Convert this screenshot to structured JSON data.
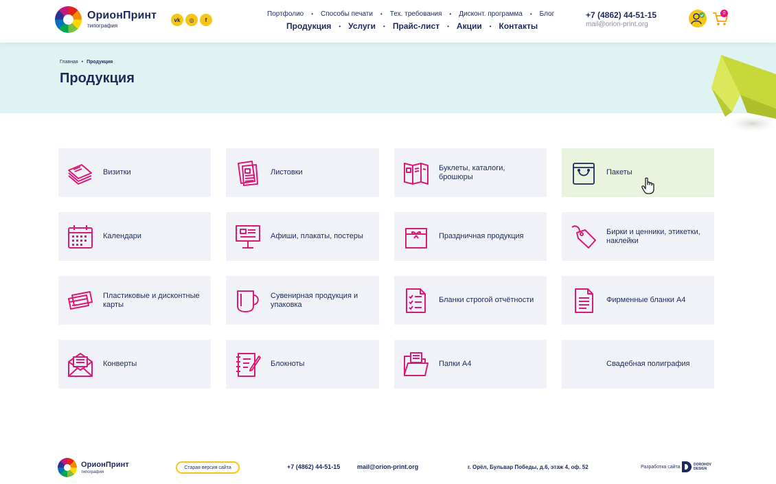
{
  "brand": {
    "name": "ОрионПринт",
    "tagline": "типография"
  },
  "socials": [
    {
      "label": "vk",
      "icon": "vk-icon"
    },
    {
      "label": "◎",
      "icon": "instagram-icon"
    },
    {
      "label": "f",
      "icon": "facebook-icon"
    }
  ],
  "nav": {
    "top": [
      "Портфолио",
      "Способы печати",
      "Тех. требования",
      "Дисконт. программа",
      "Блог"
    ],
    "main": [
      "Продукция",
      "Услуги",
      "Прайс-лист",
      "Акции",
      "Контакты"
    ]
  },
  "contacts": {
    "phone": "+7 (4862) 44-51-15",
    "email": "mail@orion-print.org"
  },
  "cart": {
    "count": "0"
  },
  "breadcrumb": {
    "home": "Главная",
    "current": "Продукция"
  },
  "page_title": "Продукция",
  "products": [
    {
      "label": "Визитки",
      "icon": "business-cards-icon"
    },
    {
      "label": "Листовки",
      "icon": "leaflets-icon"
    },
    {
      "label": "Буклеты, каталоги, брошюры",
      "icon": "booklet-icon"
    },
    {
      "label": "Пакеты",
      "icon": "bag-icon",
      "active": true
    },
    {
      "label": "Календари",
      "icon": "calendar-icon"
    },
    {
      "label": "Афиши, плакаты, постеры",
      "icon": "poster-icon"
    },
    {
      "label": "Праздничная продукция",
      "icon": "gift-box-icon"
    },
    {
      "label": "Бирки и ценники, этикетки, наклейки",
      "icon": "tag-icon"
    },
    {
      "label": "Пластиковые и дисконтные карты",
      "icon": "plastic-cards-icon"
    },
    {
      "label": "Сувенирная продукция и упаковка",
      "icon": "mug-icon"
    },
    {
      "label": "Бланки строгой отчётности",
      "icon": "checklist-form-icon"
    },
    {
      "label": "Фирменные бланки А4",
      "icon": "letterhead-icon"
    },
    {
      "label": "Конверты",
      "icon": "envelope-icon"
    },
    {
      "label": "Блокноты",
      "icon": "notepad-icon"
    },
    {
      "label": "Папки А4",
      "icon": "folder-icon"
    },
    {
      "label": "Свадебная полиграфия",
      "icon": ""
    }
  ],
  "footer": {
    "old_site": "Старая версия сайта",
    "phone": "+7 (4862) 44-51-15",
    "email": "mail@orion-print.org",
    "address": "г. Орёл, Бульвар Победы, д.6, этаж 4, оф. 52",
    "developer_label": "Разработка сайта",
    "developer_name_1": "DOROHOV",
    "developer_name_2": "DESIGN"
  },
  "colors": {
    "primary_text": "#1d2a5c",
    "accent_pink": "#d81b78",
    "accent_yellow": "#f5c518",
    "hero_bg": "#dff3f3",
    "card_bg": "#f1f2f7",
    "card_active_bg": "#e9f3dd"
  }
}
